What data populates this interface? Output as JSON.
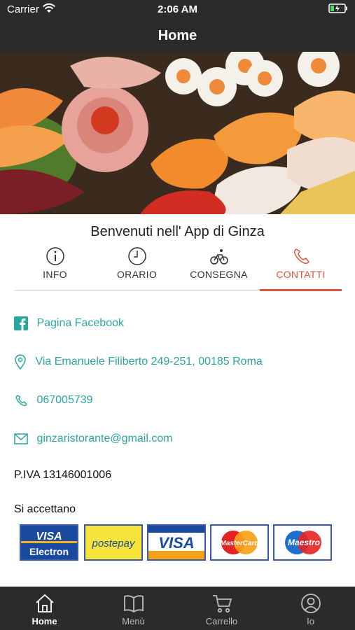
{
  "status_bar": {
    "carrier": "Carrier",
    "time": "2:06 AM"
  },
  "nav": {
    "title": "Home"
  },
  "hero": {
    "slides": 3,
    "active_slide": 2
  },
  "welcome": "Benvenuti nell' App di Ginza",
  "tabs": [
    {
      "label": "INFO",
      "icon": "info-icon"
    },
    {
      "label": "ORARIO",
      "icon": "clock-icon"
    },
    {
      "label": "CONSEGNA",
      "icon": "bicycle-icon"
    },
    {
      "label": "CONTATTI",
      "icon": "phone-icon",
      "active": true
    }
  ],
  "contacts": {
    "facebook": "Pagina Facebook",
    "address": "Via Emanuele Filiberto 249-251, 00185 Roma",
    "phone": "067005739",
    "email": "ginzaristorante@gmail.com"
  },
  "piva": "P.IVA 13146001006",
  "payments": {
    "heading": "Si accettano",
    "cards": [
      "VISA Electron",
      "postepay",
      "VISA",
      "MasterCard",
      "Maestro"
    ]
  },
  "tab_bar": [
    {
      "label": "Home",
      "icon": "home-icon",
      "active": true
    },
    {
      "label": "Menù",
      "icon": "book-icon"
    },
    {
      "label": "Carrello",
      "icon": "cart-icon"
    },
    {
      "label": "Io",
      "icon": "user-icon"
    }
  ],
  "colors": {
    "bar_bg": "#2b2b2b",
    "accent": "#e0543f",
    "link": "#2aa6a1",
    "dot_active": "#2f7fd1"
  }
}
